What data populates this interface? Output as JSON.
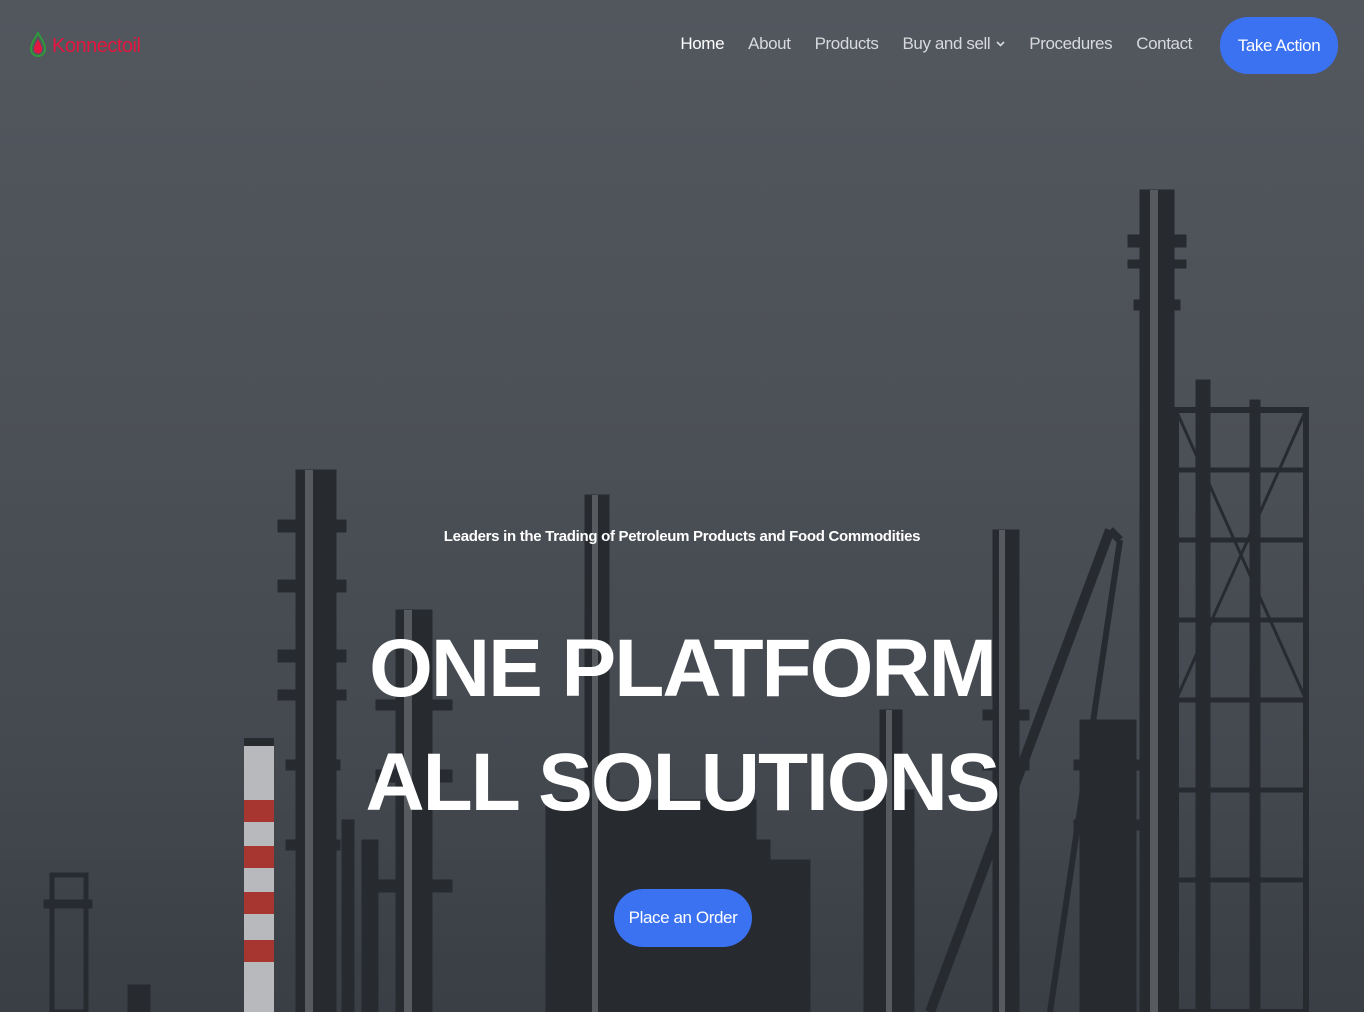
{
  "header": {
    "logo_text": "Konnectoil",
    "nav": [
      {
        "label": "Home",
        "active": true
      },
      {
        "label": "About"
      },
      {
        "label": "Products"
      },
      {
        "label": "Buy and sell",
        "has_dropdown": true
      },
      {
        "label": "Procedures"
      },
      {
        "label": "Contact"
      }
    ],
    "cta_label": "Take Action"
  },
  "hero": {
    "tagline": "Leaders in the Trading of Petroleum Products and Food Commodities",
    "headline": "ONE PLATFORM ALL SOLUTIONS",
    "button_label": "Place an Order"
  },
  "colors": {
    "accent": "#3b72f2",
    "logo_red": "#e3173f",
    "logo_green": "#2e9b3a"
  }
}
